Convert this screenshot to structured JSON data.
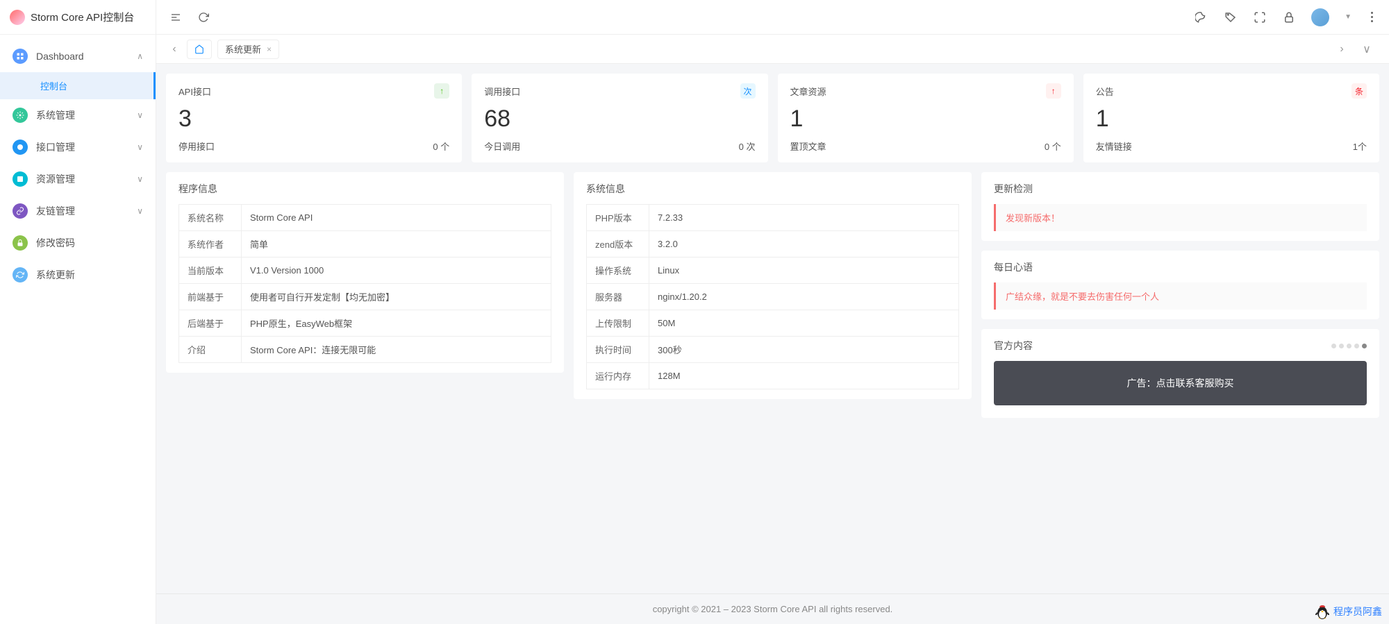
{
  "app_title": "Storm Core API控制台",
  "sidebar": {
    "items": [
      {
        "label": "Dashboard",
        "color": "#5b9bff"
      },
      {
        "label": "系统管理",
        "color": "#33c79a"
      },
      {
        "label": "接口管理",
        "color": "#2196f3"
      },
      {
        "label": "资源管理",
        "color": "#00bcd4"
      },
      {
        "label": "友链管理",
        "color": "#7e57c2"
      },
      {
        "label": "修改密码",
        "color": "#8bc34a"
      },
      {
        "label": "系统更新",
        "color": "#64b5f6"
      }
    ],
    "active_sub": "控制台"
  },
  "tabs": {
    "current": "系统更新"
  },
  "stats": [
    {
      "title": "API接口",
      "badge": "↑",
      "bcolor": "#e8f5e9",
      "btxt": "#52c41a",
      "num": "3",
      "sub": "停用接口",
      "subv": "0 个"
    },
    {
      "title": "调用接口",
      "badge": "次",
      "bcolor": "#e6f7ff",
      "btxt": "#1890ff",
      "num": "68",
      "sub": "今日调用",
      "subv": "0 次"
    },
    {
      "title": "文章资源",
      "badge": "↑",
      "bcolor": "#fff1f0",
      "btxt": "#f5222d",
      "num": "1",
      "sub": "置顶文章",
      "subv": "0 个"
    },
    {
      "title": "公告",
      "badge": "条",
      "bcolor": "#fff1f0",
      "btxt": "#f5222d",
      "num": "1",
      "sub": "友情链接",
      "subv": "1个"
    }
  ],
  "program_info": {
    "title": "程序信息",
    "rows": [
      {
        "k": "系统名称",
        "v": "Storm Core API"
      },
      {
        "k": "系统作者",
        "v": "简单"
      },
      {
        "k": "当前版本",
        "v": "V1.0 Version 1000"
      },
      {
        "k": "前端基于",
        "v": "使用者可自行开发定制【均无加密】"
      },
      {
        "k": "后端基于",
        "v": "PHP原生，EasyWeb框架"
      },
      {
        "k": "介绍",
        "v": "Storm Core API：连接无限可能"
      }
    ]
  },
  "system_info": {
    "title": "系统信息",
    "rows": [
      {
        "k": "PHP版本",
        "v": "7.2.33"
      },
      {
        "k": "zend版本",
        "v": "3.2.0"
      },
      {
        "k": "操作系统",
        "v": "Linux"
      },
      {
        "k": "服务器",
        "v": "nginx/1.20.2"
      },
      {
        "k": "上传限制",
        "v": "50M"
      },
      {
        "k": "执行时间",
        "v": "300秒"
      },
      {
        "k": "运行内存",
        "v": "128M"
      }
    ]
  },
  "update_check": {
    "title": "更新检测",
    "msg": "发现新版本！"
  },
  "daily": {
    "title": "每日心语",
    "msg": "广结众缘，就是不要去伤害任何一个人"
  },
  "official": {
    "title": "官方内容",
    "ad": "广告：点击联系客服购买"
  },
  "footer": "copyright © 2021 – 2023 Storm Core API all rights reserved.",
  "watermark": "程序员阿鑫"
}
